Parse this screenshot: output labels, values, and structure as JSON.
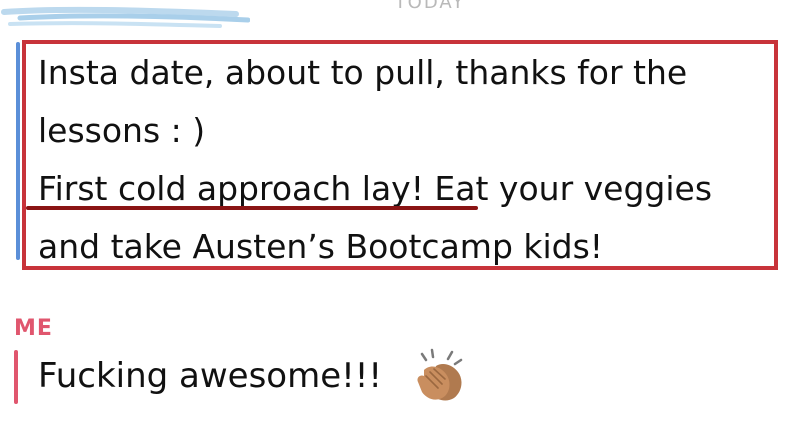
{
  "header": {
    "date_label": "TODAY"
  },
  "messages": {
    "incoming": {
      "lines": [
        "Insta date, about to pull, thanks for the",
        "lessons : )",
        "First cold approach lay! Eat your veggies",
        "and take Austen’s Bootcamp kids!"
      ],
      "bar_color": "#5b8fd8"
    },
    "outgoing": {
      "sender": "ME",
      "text": "Fucking awesome!!!",
      "emoji": "clapping-hands-icon",
      "accent_color": "#e0566e"
    }
  },
  "annotations": {
    "box_color": "#c8333a",
    "underline_color": "#8a1414"
  }
}
